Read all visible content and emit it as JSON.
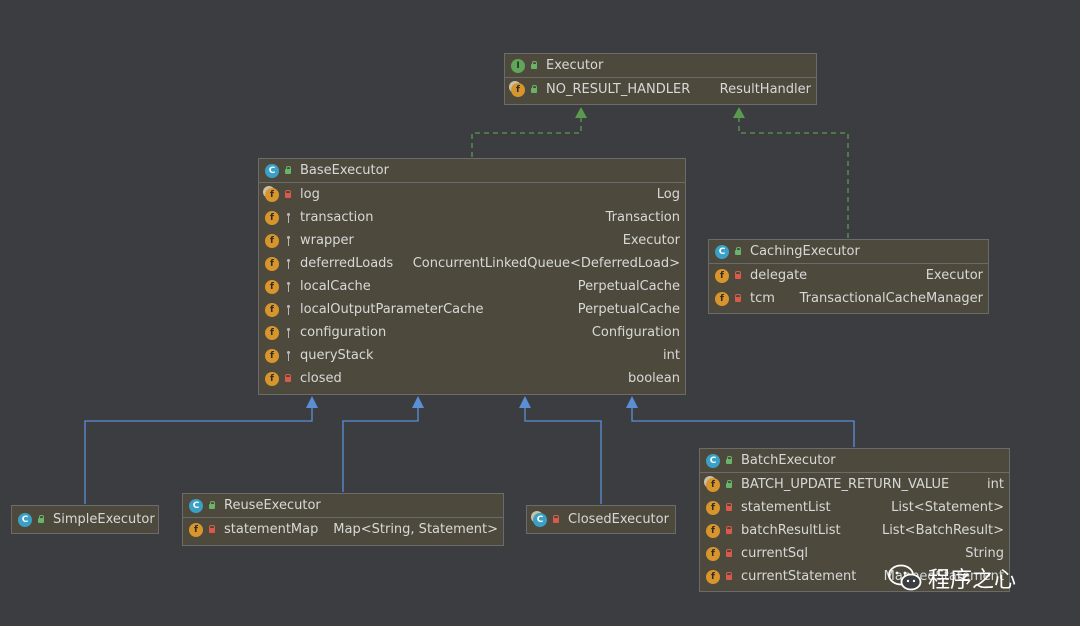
{
  "diagram": {
    "nodes": {
      "executor": {
        "title": "Executor",
        "stereotype_icon": "interface-icon",
        "fields": [
          {
            "name": "NO_RESULT_HANDLER",
            "type": "ResultHandler",
            "visibility": "public",
            "static": true
          }
        ]
      },
      "base_executor": {
        "title": "BaseExecutor",
        "stereotype_icon": "abstract-class-icon",
        "fields": [
          {
            "name": "log",
            "type": "Log",
            "visibility": "private",
            "static": true
          },
          {
            "name": "transaction",
            "type": "Transaction",
            "visibility": "protected"
          },
          {
            "name": "wrapper",
            "type": "Executor",
            "visibility": "protected"
          },
          {
            "name": "deferredLoads",
            "type": "ConcurrentLinkedQueue<DeferredLoad>",
            "visibility": "protected"
          },
          {
            "name": "localCache",
            "type": "PerpetualCache",
            "visibility": "protected"
          },
          {
            "name": "localOutputParameterCache",
            "type": "PerpetualCache",
            "visibility": "protected"
          },
          {
            "name": "configuration",
            "type": "Configuration",
            "visibility": "protected"
          },
          {
            "name": "queryStack",
            "type": "int",
            "visibility": "protected"
          },
          {
            "name": "closed",
            "type": "boolean",
            "visibility": "private"
          }
        ]
      },
      "caching_executor": {
        "title": "CachingExecutor",
        "stereotype_icon": "class-icon",
        "fields": [
          {
            "name": "delegate",
            "type": "Executor",
            "visibility": "private"
          },
          {
            "name": "tcm",
            "type": "TransactionalCacheManager",
            "visibility": "private"
          }
        ]
      },
      "simple_executor": {
        "title": "SimpleExecutor",
        "stereotype_icon": "class-icon",
        "fields": []
      },
      "reuse_executor": {
        "title": "ReuseExecutor",
        "stereotype_icon": "class-icon",
        "fields": [
          {
            "name": "statementMap",
            "type": "Map<String, Statement>",
            "visibility": "private"
          }
        ]
      },
      "closed_executor": {
        "title": "ClosedExecutor",
        "stereotype_icon": "class-icon",
        "fields": []
      },
      "batch_executor": {
        "title": "BatchExecutor",
        "stereotype_icon": "class-icon",
        "fields": [
          {
            "name": "BATCH_UPDATE_RETURN_VALUE",
            "type": "int",
            "visibility": "public",
            "static": true
          },
          {
            "name": "statementList",
            "type": "List<Statement>",
            "visibility": "private"
          },
          {
            "name": "batchResultList",
            "type": "List<BatchResult>",
            "visibility": "private"
          },
          {
            "name": "currentSql",
            "type": "String",
            "visibility": "private"
          },
          {
            "name": "currentStatement",
            "type": "MappedStatement",
            "visibility": "private"
          }
        ]
      }
    },
    "edges": [
      {
        "from": "base_executor",
        "to": "executor",
        "kind": "implements"
      },
      {
        "from": "caching_executor",
        "to": "executor",
        "kind": "implements"
      },
      {
        "from": "simple_executor",
        "to": "base_executor",
        "kind": "extends"
      },
      {
        "from": "reuse_executor",
        "to": "base_executor",
        "kind": "extends"
      },
      {
        "from": "closed_executor",
        "to": "base_executor",
        "kind": "extends"
      },
      {
        "from": "batch_executor",
        "to": "base_executor",
        "kind": "extends"
      }
    ],
    "colors": {
      "background": "#3b3d40",
      "box_fill": "#4d4a3d",
      "implements_edge": "#5a9a4f",
      "extends_edge": "#5a8fd6"
    }
  },
  "watermark": {
    "text": "程序之心",
    "icon": "wechat-icon"
  }
}
